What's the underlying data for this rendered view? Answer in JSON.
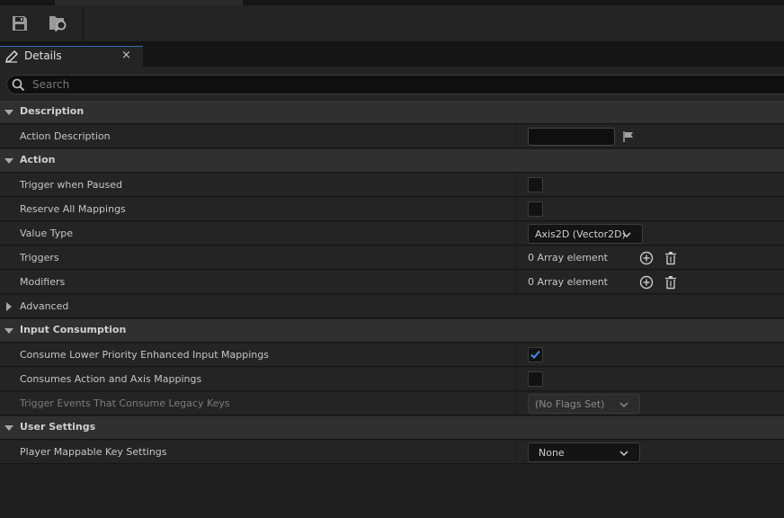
{
  "toolbar": {
    "save_icon": "save-icon",
    "browse_icon": "browse-to-asset-icon"
  },
  "tab": {
    "title": "Details",
    "close": "×"
  },
  "search": {
    "placeholder": "Search"
  },
  "sections": {
    "description": {
      "title": "Description",
      "action_description": {
        "label": "Action Description",
        "value": ""
      }
    },
    "action": {
      "title": "Action",
      "trigger_when_paused": {
        "label": "Trigger when Paused",
        "checked": false
      },
      "reserve_all_mappings": {
        "label": "Reserve All Mappings",
        "checked": false
      },
      "value_type": {
        "label": "Value Type",
        "value": "Axis2D (Vector2D)"
      },
      "triggers": {
        "label": "Triggers",
        "value": "0 Array element"
      },
      "modifiers": {
        "label": "Modifiers",
        "value": "0 Array element"
      },
      "advanced": {
        "label": "Advanced"
      }
    },
    "input_consumption": {
      "title": "Input Consumption",
      "consume_lower": {
        "label": "Consume Lower Priority Enhanced Input Mappings",
        "checked": true
      },
      "consumes_action_axis": {
        "label": "Consumes Action and Axis Mappings",
        "checked": false
      },
      "trigger_events_legacy": {
        "label": "Trigger Events That Consume Legacy Keys",
        "value": "(No Flags Set)"
      }
    },
    "user_settings": {
      "title": "User Settings",
      "player_mappable": {
        "label": "Player Mappable Key Settings",
        "value": "None"
      }
    }
  },
  "colors": {
    "accent": "#2f6fb3",
    "checkmark": "#3d8fe6",
    "panel": "#242424",
    "category": "#303030"
  }
}
